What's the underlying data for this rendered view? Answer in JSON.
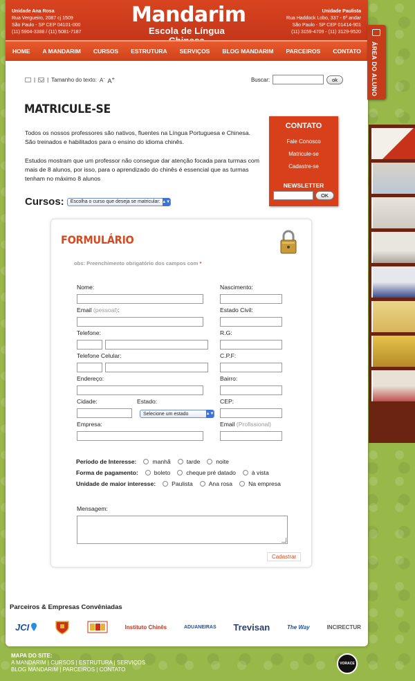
{
  "header": {
    "left_unit": "Unidade Ana Rosa",
    "left_line1": "Rua Vergueiro, 2087 cj 1509",
    "left_line2": "São Paulo - SP CEP 04101-000",
    "left_line3": "(11) 5904-3388 / (11) 5081-7187",
    "brand": "Mandarim",
    "tagline": "Escola de Língua Chinesa",
    "right_unit": "Unidade Paulista",
    "right_line1": "Rua Haddock Lobo, 337 - 6º andar",
    "right_line2": "São Paulo - SP CEP 01414-901",
    "right_line3": "(11) 3159-4709 - (11) 3129-9520"
  },
  "nav": [
    "HOME",
    "A MANDARIM",
    "CURSOS",
    "ESTRUTURA",
    "SERVIÇOS",
    "BLOG MANDARIM",
    "PARCEIROS",
    "CONTATO"
  ],
  "side_tab": "ÁREA DO ALUNO",
  "toolbar": {
    "sep": "|",
    "text_size_label": "Tamanho do texto:",
    "a_minus": "A",
    "a_minus_sup": "-",
    "a_plus": "A",
    "a_plus_sup": "+",
    "search_label": "Buscar:",
    "search_button": "ok"
  },
  "page_title": "MATRICULE-SE",
  "intro": {
    "p1": "Todos os nossos professores são nativos, fluentes na Língua Portuguesa e Chinesa. São treinados e habilitados para o ensino do idioma chinês.",
    "p2": "Estudos mostram que um professor não consegue dar atenção focada para turmas com mais de 8 alunos, por isso, para o aprendizado do chinês é essencial que as turmas tenham no máximo 8 alunos"
  },
  "contato": {
    "title": "CONTATO",
    "links": [
      "Fale Conosco",
      "Matricule-se",
      "Cadastre-se"
    ],
    "newsletter": "NEWSLETTER",
    "ok": "OK"
  },
  "cursos": {
    "label": "Cursos:",
    "select": "Escolha o curso que deseja se matricular:"
  },
  "form": {
    "title": "FORMULÁRIO",
    "obs": "obs: Preenchimento obrigatório dos campos com",
    "asterisk": "*",
    "nome": "Nome:",
    "nascimento": "Nascimento:",
    "email": "Email",
    "email_muted": "(pessoal)",
    "colon": ":",
    "estado_civil": "Estado Civil:",
    "telefone": "Telefone:",
    "rg": "R.G:",
    "celular": "Telefone Celular:",
    "cpf": "C.P.F:",
    "endereco": "Endereço:",
    "bairro": "Bairro:",
    "cidade": "Cidade:",
    "estado": "Estado:",
    "estado_select": "Selecione um estado",
    "cep": "CEP:",
    "empresa": "Empresa:",
    "email_prof": "Email",
    "email_prof_muted": "(Profissional)",
    "periodo": "Período de Interesse:",
    "periodo_opts": [
      "manhã",
      "tarde",
      "noite"
    ],
    "pagamento": "Forma de pagamento:",
    "pagamento_opts": [
      "boleto",
      "cheque pré datado",
      "à vista"
    ],
    "unidade": "Unidade de maior interesse:",
    "unidade_opts": [
      "Paulista",
      "Ana rosa",
      "Na empresa"
    ],
    "mensagem": "Mensagem:",
    "submit": "Cadastrar"
  },
  "partners": {
    "title": "Parceiros & Empresas Convêniadas",
    "logos": [
      "JCI",
      "",
      "",
      "Instituto Chinês",
      "ADUANEIRAS",
      "Trevisan",
      "The Way",
      "INCIRECTUR"
    ]
  },
  "footer": {
    "title": "MAPA DO SITE:",
    "line1": "A MANDARIM | CURSOS | ESTRUTURA | SERVIÇOS",
    "line2": "BLOG MANDARIM | PARCEIROS | CONTATO",
    "badge": "VORACE"
  },
  "colors": {
    "brand": "#d7401a",
    "background": "#98b84a",
    "form_title": "#d64a20"
  }
}
